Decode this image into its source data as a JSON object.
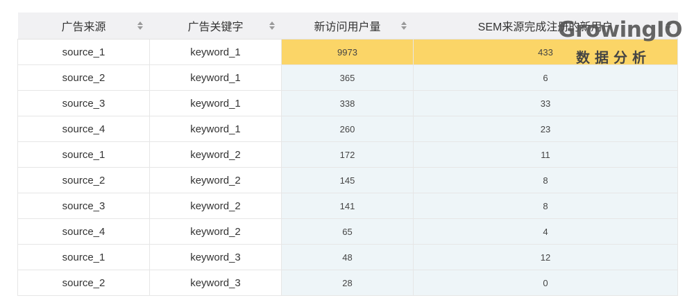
{
  "table": {
    "headers": [
      {
        "label": "广告来源"
      },
      {
        "label": "广告关键字"
      },
      {
        "label": "新访问用户量"
      },
      {
        "label": "SEM来源完成注册的新用户"
      }
    ],
    "rows": [
      {
        "source": "source_1",
        "keyword": "keyword_1",
        "new_visits": "9973",
        "registered": "433"
      },
      {
        "source": "source_2",
        "keyword": "keyword_1",
        "new_visits": "365",
        "registered": "6"
      },
      {
        "source": "source_3",
        "keyword": "keyword_1",
        "new_visits": "338",
        "registered": "33"
      },
      {
        "source": "source_4",
        "keyword": "keyword_1",
        "new_visits": "260",
        "registered": "23"
      },
      {
        "source": "source_1",
        "keyword": "keyword_2",
        "new_visits": "172",
        "registered": "11"
      },
      {
        "source": "source_2",
        "keyword": "keyword_2",
        "new_visits": "145",
        "registered": "8"
      },
      {
        "source": "source_3",
        "keyword": "keyword_2",
        "new_visits": "141",
        "registered": "8"
      },
      {
        "source": "source_4",
        "keyword": "keyword_2",
        "new_visits": "65",
        "registered": "4"
      },
      {
        "source": "source_1",
        "keyword": "keyword_3",
        "new_visits": "48",
        "registered": "12"
      },
      {
        "source": "source_2",
        "keyword": "keyword_3",
        "new_visits": "28",
        "registered": "0"
      }
    ],
    "highlight_color": "#fbd567",
    "metric_column_bg": "#eef5f8",
    "header_bg": "#f1f1f3",
    "sort_icon": "sort-updown-icon"
  },
  "watermark": {
    "brand": "GrowingIO",
    "subtitle": "数据分析"
  }
}
